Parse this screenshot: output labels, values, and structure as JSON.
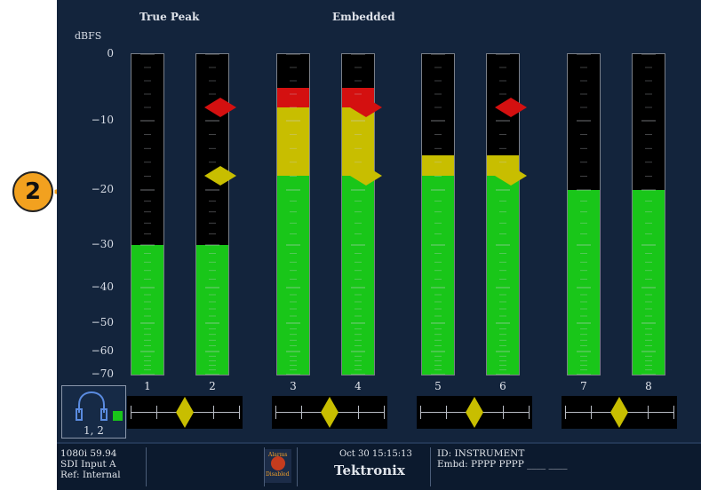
{
  "headers": {
    "left": "True Peak",
    "center": "Embedded"
  },
  "scale": {
    "unit": "dBFS",
    "ticks": [
      "0",
      "−10",
      "−20",
      "−30",
      "−40",
      "−50",
      "−60",
      "−70"
    ]
  },
  "channels": [
    {
      "label": "1",
      "green_top_dB": -30,
      "yellow_top_dB": null,
      "red_top_dB": null
    },
    {
      "label": "2",
      "green_top_dB": -30,
      "yellow_top_dB": null,
      "red_top_dB": null
    },
    {
      "label": "3",
      "green_top_dB": -18,
      "yellow_top_dB": -8,
      "red_top_dB": -5
    },
    {
      "label": "4",
      "green_top_dB": -18,
      "yellow_top_dB": -8,
      "red_top_dB": -5
    },
    {
      "label": "5",
      "green_top_dB": -18,
      "yellow_top_dB": -15,
      "red_top_dB": null
    },
    {
      "label": "6",
      "green_top_dB": -18,
      "yellow_top_dB": -15,
      "red_top_dB": null
    },
    {
      "label": "7",
      "green_top_dB": -20,
      "yellow_top_dB": null,
      "red_top_dB": null
    },
    {
      "label": "8",
      "green_top_dB": -20,
      "yellow_top_dB": null,
      "red_top_dB": null
    }
  ],
  "thresholds": {
    "over_dB": -8,
    "test_dB": -18
  },
  "colors": {
    "green": "#19c619",
    "yellow": "#c8be00",
    "red": "#d41010",
    "screen": "#13243c",
    "callout": "#f2a11f"
  },
  "phase_meters": [
    {
      "pair": "1-2",
      "correlation": 0.0
    },
    {
      "pair": "3-4",
      "correlation": 0.0
    },
    {
      "pair": "5-6",
      "correlation": 0.0
    },
    {
      "pair": "7-8",
      "correlation": 0.0
    }
  ],
  "headphone": {
    "icon": "headphones-icon",
    "label": "1, 2"
  },
  "status": {
    "format": "1080i 59.94",
    "input": "SDI Input A",
    "ref": "Ref: Internal",
    "alarm_line1": "Alarms",
    "alarm_line2": "Disabled",
    "datetime": "Oct 30 15:15:13",
    "brand": "Tektronix",
    "id": "ID: INSTRUMENT",
    "embd": "Embd: PPPP PPPP ____ ____"
  },
  "callout": {
    "number": "2"
  }
}
